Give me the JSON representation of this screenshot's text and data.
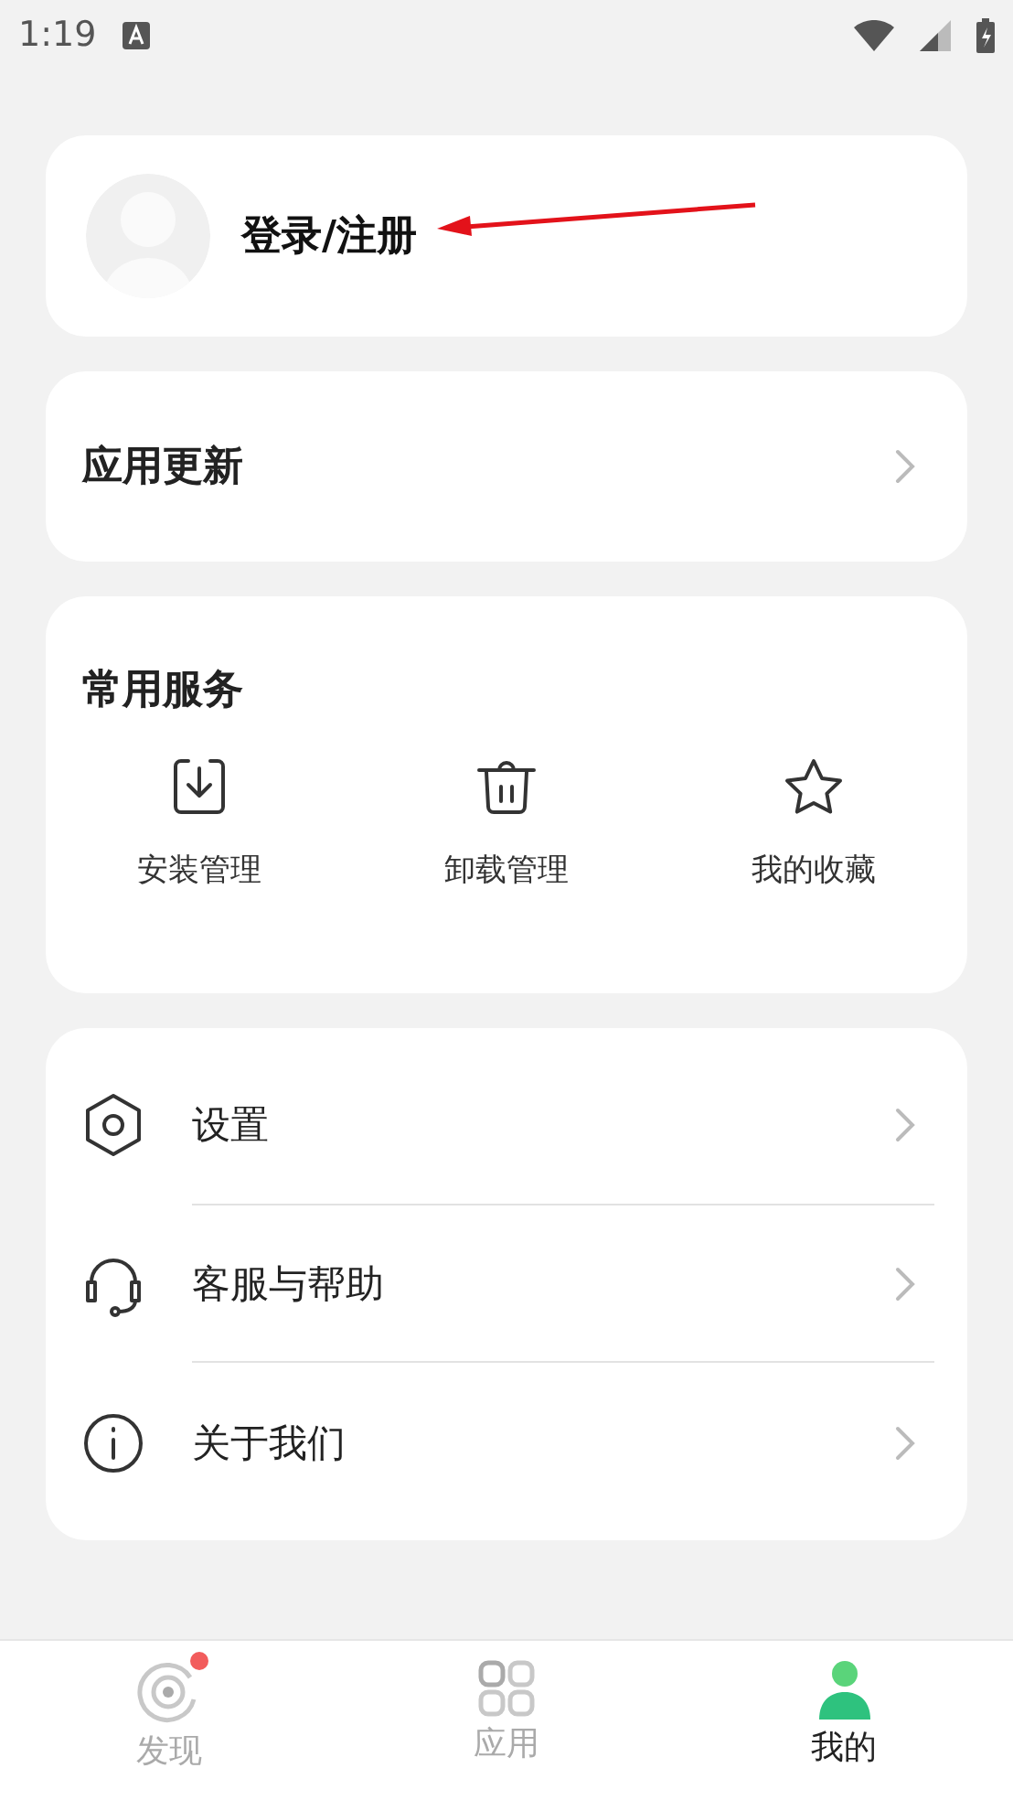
{
  "status_bar": {
    "time": "1:19"
  },
  "profile": {
    "login_label": "登录/注册"
  },
  "update": {
    "label": "应用更新"
  },
  "services": {
    "title": "常用服务",
    "items": [
      {
        "kind": "install",
        "label": "安装管理"
      },
      {
        "kind": "uninstall",
        "label": "卸载管理"
      },
      {
        "kind": "favorite",
        "label": "我的收藏"
      }
    ]
  },
  "menu": [
    {
      "kind": "settings",
      "label": "设置"
    },
    {
      "kind": "support",
      "label": "客服与帮助"
    },
    {
      "kind": "about",
      "label": "关于我们"
    }
  ],
  "bottom_nav": [
    {
      "kind": "discover",
      "label": "发现",
      "selected": false,
      "badge": true
    },
    {
      "kind": "apps",
      "label": "应用",
      "selected": false,
      "badge": false
    },
    {
      "kind": "me",
      "label": "我的",
      "selected": true,
      "badge": false
    }
  ]
}
